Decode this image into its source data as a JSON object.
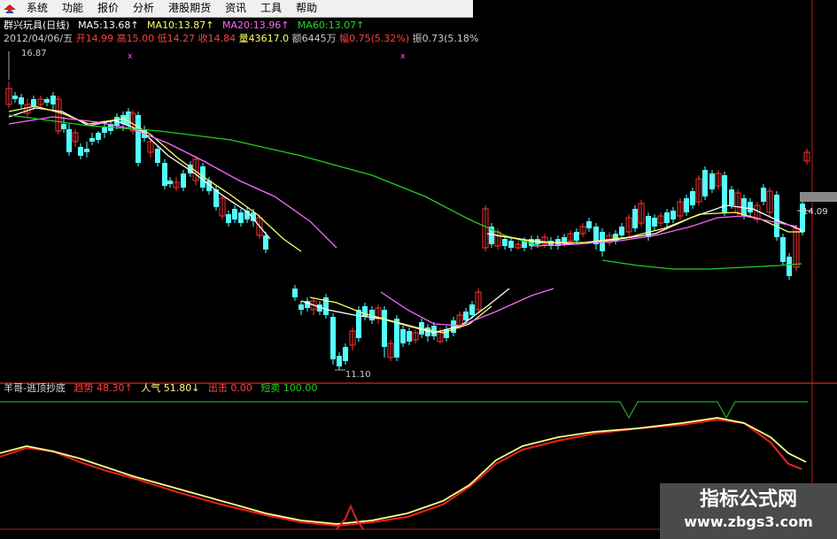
{
  "menu": {
    "items": [
      "系统",
      "功能",
      "报价",
      "分析",
      "港股期货",
      "资讯",
      "工具",
      "帮助"
    ]
  },
  "header": {
    "stock": "群兴玩具(日线)",
    "ma5_label": "MA5:",
    "ma5": "13.68↑",
    "ma10_label": "MA10:",
    "ma10": "13.87↑",
    "ma20_label": "MA20:",
    "ma20": "13.96↑",
    "ma60_label": "MA60:",
    "ma60": "13.07↑",
    "date": "2012/04/06/五",
    "open_label": "开",
    "open": "14.99",
    "high_label": "高",
    "high": "15.00",
    "low_label": "低",
    "low": "14.27",
    "close_label": "收",
    "close": "14.84",
    "volume_label": "量",
    "volume": "43617.0",
    "amount_label": "额",
    "amount": "6445万",
    "change_label": "幅",
    "change": "0.75(5.32%)",
    "amp_label": "振",
    "amp": "0.73(5.18%"
  },
  "price_labels": {
    "high_mark": "16.87",
    "low_mark": "11.10",
    "current_price": "14.09"
  },
  "indicator": {
    "name": "羊哥-逃顶抄底",
    "trend_label": "趋势",
    "trend": "48.30↑",
    "pop_label": "人气",
    "pop": "51.80↓",
    "sell_label": "出击",
    "sell": "0.00",
    "hold_label": "短卖",
    "hold": "100.00"
  },
  "watermark": {
    "title": "指标公式网",
    "url": "www.zbgs3.com"
  },
  "colors": {
    "up": "#ff3232",
    "down": "#54ffff",
    "ma5": "#ffffff",
    "ma10": "#ffff66",
    "ma20": "#ff66ff",
    "ma60": "#22cc22",
    "trend_line": "#dd2020",
    "pop_line": "#ffff88"
  },
  "icons": [
    "app-logo-icon",
    "price-arrow-icon"
  ]
}
